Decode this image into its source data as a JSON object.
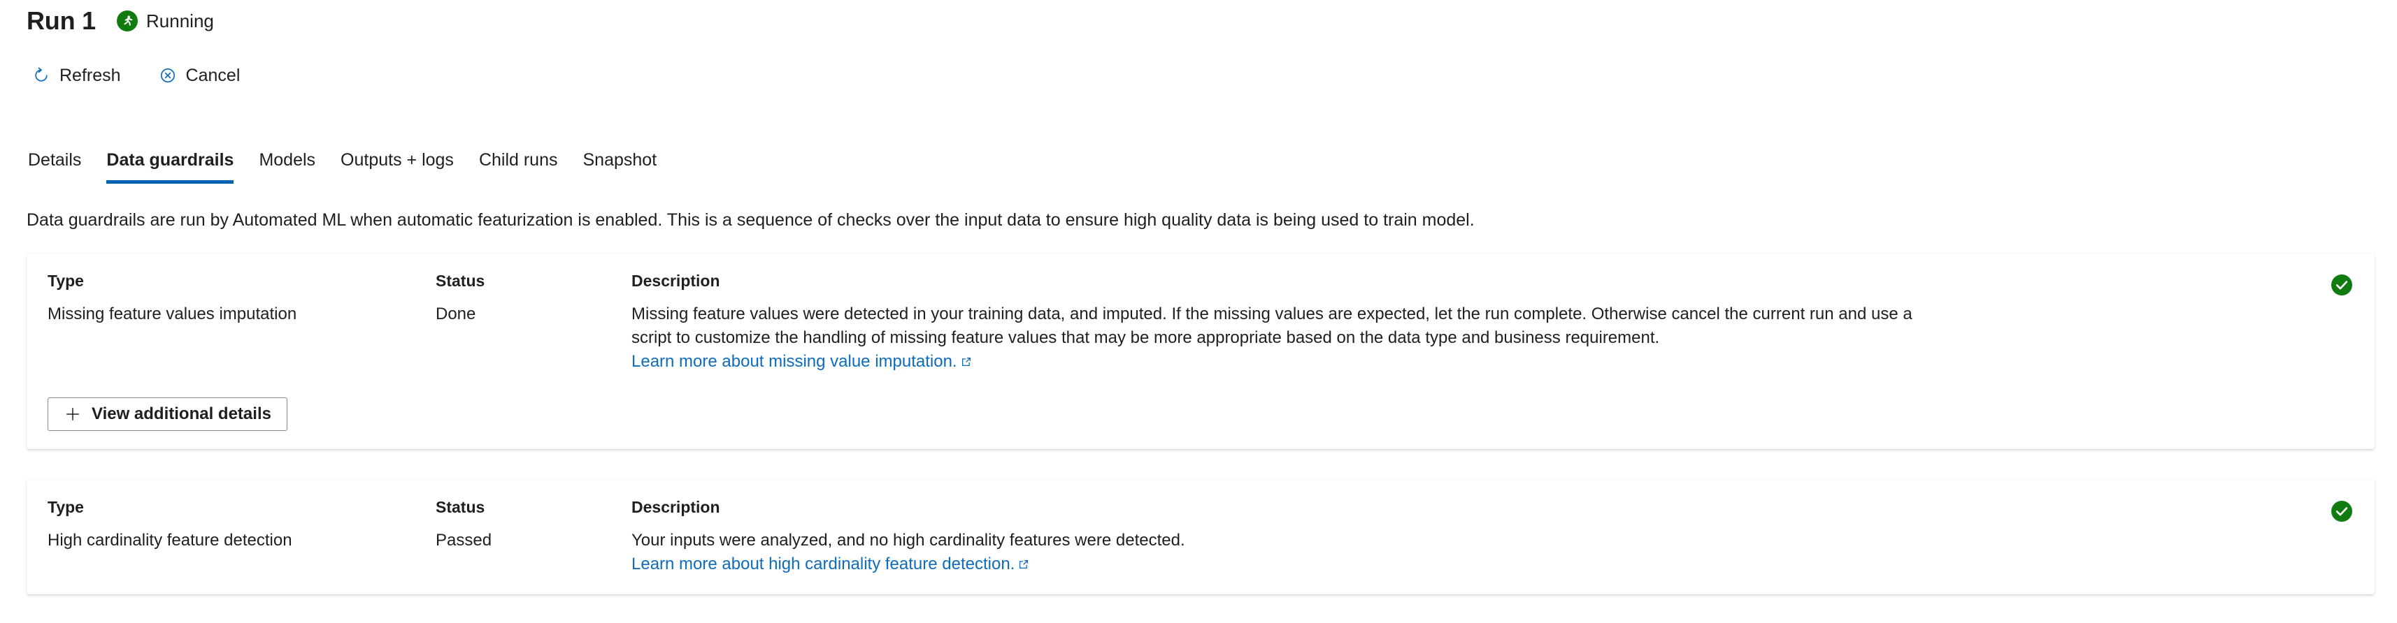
{
  "header": {
    "run_title": "Run 1",
    "status_label": "Running",
    "status_icon": "running-person-icon",
    "status_color": "#107C10"
  },
  "command_bar": {
    "buttons": [
      {
        "label": "Refresh",
        "icon": "refresh-icon"
      },
      {
        "label": "Cancel",
        "icon": "cancel-circle-icon"
      }
    ],
    "icon_color": "#0f6cbd"
  },
  "tabs": {
    "items": [
      {
        "label": "Details",
        "active": false
      },
      {
        "label": "Data guardrails",
        "active": true
      },
      {
        "label": "Models",
        "active": false
      },
      {
        "label": "Outputs + logs",
        "active": false
      },
      {
        "label": "Child runs",
        "active": false
      },
      {
        "label": "Snapshot",
        "active": false
      }
    ],
    "active_underline_color": "#0063B1"
  },
  "intro": {
    "text": "Data guardrails are run by Automated ML when automatic featurization is enabled. This is a sequence of checks over the input data to ensure high quality data is being used to train model."
  },
  "columns": {
    "type": "Type",
    "status": "Status",
    "description": "Description"
  },
  "cards": [
    {
      "type": "Missing feature values imputation",
      "status": "Done",
      "description_lines": [
        "Missing feature values were detected in your training data, and imputed. If the missing values are expected, let the run complete. Otherwise cancel the current run and use a",
        "script to customize the handling of missing feature values that may be more appropriate based on the data type and business requirement."
      ],
      "link_text": "Learn more about missing value imputation.",
      "link_icon": "external-link-icon",
      "status_icon": "success-check-icon",
      "status_icon_color": "#107C10",
      "button": {
        "label": "View additional details",
        "icon": "plus-icon"
      }
    },
    {
      "type": "High cardinality feature detection",
      "status": "Passed",
      "description_lines": [
        "Your inputs were analyzed, and no high cardinality features were detected."
      ],
      "link_text": "Learn more about high cardinality feature detection.",
      "link_icon": "external-link-icon",
      "status_icon": "success-check-icon",
      "status_icon_color": "#107C10"
    }
  ],
  "colors": {
    "link": "#0f6cbd",
    "text": "#201f1e",
    "card_bg": "#ffffff",
    "page_bg": "#ffffff"
  }
}
